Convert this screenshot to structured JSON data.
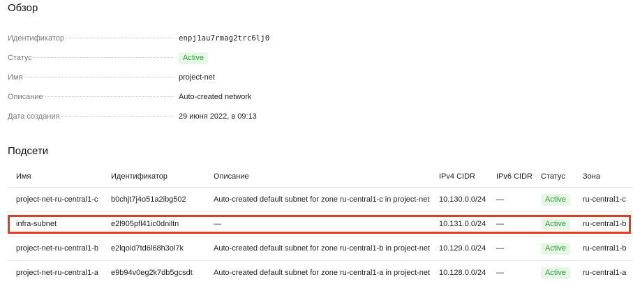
{
  "overview": {
    "title": "Обзор",
    "properties": [
      {
        "label": "Идентификатор",
        "value": "enpj1au7rmag2trc6lj0"
      },
      {
        "label": "Статус",
        "value": "Active"
      },
      {
        "label": "Имя",
        "value": "project-net"
      },
      {
        "label": "Описание",
        "value": "Auto-created network"
      },
      {
        "label": "Дата создания",
        "value": "29 июня 2022, в 09:13"
      }
    ]
  },
  "subnets": {
    "title": "Подсети",
    "columns": {
      "name": "Имя",
      "id": "Идентификатор",
      "description": "Описание",
      "ipv4": "IPv4 CIDR",
      "ipv6": "IPv6 CIDR",
      "status": "Статус",
      "zone": "Зона"
    },
    "rows": [
      {
        "name": "project-net-ru-central1-c",
        "id": "b0chjt7j4o51a2ibg502",
        "description": "Auto-created default subnet for zone ru-central1-c in project-net",
        "ipv4": "10.130.0.0/24",
        "ipv6": "—",
        "status": "Active",
        "zone": "ru-central1-c"
      },
      {
        "name": "infra-subnet",
        "id": "e2l905pfl41ic0dniltn",
        "description": "—",
        "ipv4": "10.131.0.0/24",
        "ipv6": "—",
        "status": "Active",
        "zone": "ru-central1-b"
      },
      {
        "name": "project-net-ru-central1-b",
        "id": "e2lqoid7td6l68h3ol7k",
        "description": "Auto-created default subnet for zone ru-central1-b in project-net",
        "ipv4": "10.129.0.0/24",
        "ipv6": "—",
        "status": "Active",
        "zone": "ru-central1-b"
      },
      {
        "name": "project-net-ru-central1-a",
        "id": "e9b94v0eg2k7db5gcsdt",
        "description": "Auto-created default subnet for zone ru-central1-a in project-net",
        "ipv4": "10.128.0.0/24",
        "ipv6": "—",
        "status": "Active",
        "zone": "ru-central1-a"
      }
    ]
  },
  "colors": {
    "highlight": "#e8391e",
    "status_bg": "#e6f7e6",
    "status_text": "#2f9e36"
  }
}
